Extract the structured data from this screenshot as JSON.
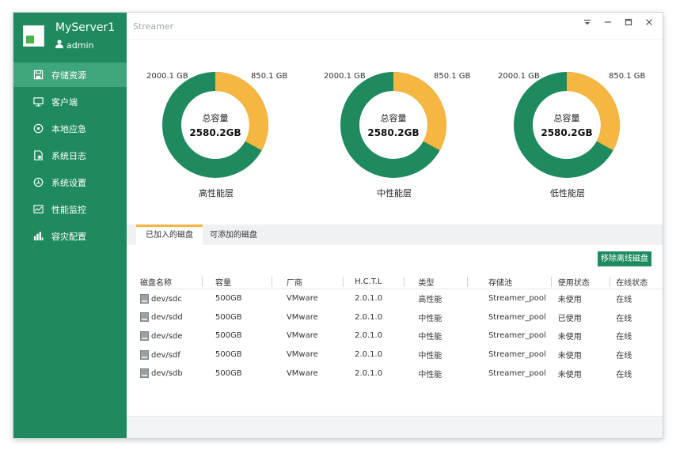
{
  "sidebar": {
    "server_name": "MyServer1",
    "user": "admin",
    "items": [
      {
        "label": "存储资源",
        "icon": "save-icon",
        "active": true
      },
      {
        "label": "客户端",
        "icon": "monitor-icon",
        "active": false
      },
      {
        "label": "本地应急",
        "icon": "disc-icon",
        "active": false
      },
      {
        "label": "系统日志",
        "icon": "log-icon",
        "active": false
      },
      {
        "label": "系统设置",
        "icon": "settings-icon",
        "active": false
      },
      {
        "label": "性能监控",
        "icon": "chart-icon",
        "active": false
      },
      {
        "label": "容灾配置",
        "icon": "backup-icon",
        "active": false
      }
    ]
  },
  "titlebar": {
    "title": "Streamer"
  },
  "tiers": [
    {
      "name": "高性能层",
      "total_label": "总容量",
      "total_value": "2580.2GB",
      "free_label": "2000.1 GB",
      "used_label": "850.1 GB",
      "used_fraction": 0.3295
    },
    {
      "name": "中性能层",
      "total_label": "总容量",
      "total_value": "2580.2GB",
      "free_label": "2000.1 GB",
      "used_label": "850.1 GB",
      "used_fraction": 0.3295
    },
    {
      "name": "低性能层",
      "total_label": "总容量",
      "total_value": "2580.2GB",
      "free_label": "2000.1 GB",
      "used_label": "850.1 GB",
      "used_fraction": 0.3295
    }
  ],
  "colors": {
    "brand": "#1e8a5e",
    "ring_free": "#1e8a5e",
    "ring_used": "#f5b642",
    "active_tab": "#f5b642"
  },
  "tabs": [
    {
      "label": "已加入的磁盘",
      "active": true
    },
    {
      "label": "可添加的磁盘",
      "active": false
    }
  ],
  "remove_button": "移除离线磁盘",
  "table": {
    "headers": [
      "磁盘名称",
      "容量",
      "厂商",
      "H.C.T.L",
      "类型",
      "存储池",
      "使用状态",
      "在线状态"
    ],
    "rows": [
      [
        "dev/sdc",
        "500GB",
        "VMware",
        "2.0.1.0",
        "高性能",
        "Streamer_pool",
        "未使用",
        "在线"
      ],
      [
        "dev/sdd",
        "500GB",
        "VMware",
        "2.0.1.0",
        "中性能",
        "Streamer_pool",
        "已使用",
        "在线"
      ],
      [
        "dev/sde",
        "500GB",
        "VMware",
        "2.0.1.0",
        "中性能",
        "Streamer_pool",
        "未使用",
        "在线"
      ],
      [
        "dev/sdf",
        "500GB",
        "VMware",
        "2.0.1.0",
        "中性能",
        "Streamer_pool",
        "未使用",
        "在线"
      ],
      [
        "dev/sdb",
        "500GB",
        "VMware",
        "2.0.1.0",
        "中性能",
        "Streamer_pool",
        "未使用",
        "在线"
      ]
    ]
  }
}
